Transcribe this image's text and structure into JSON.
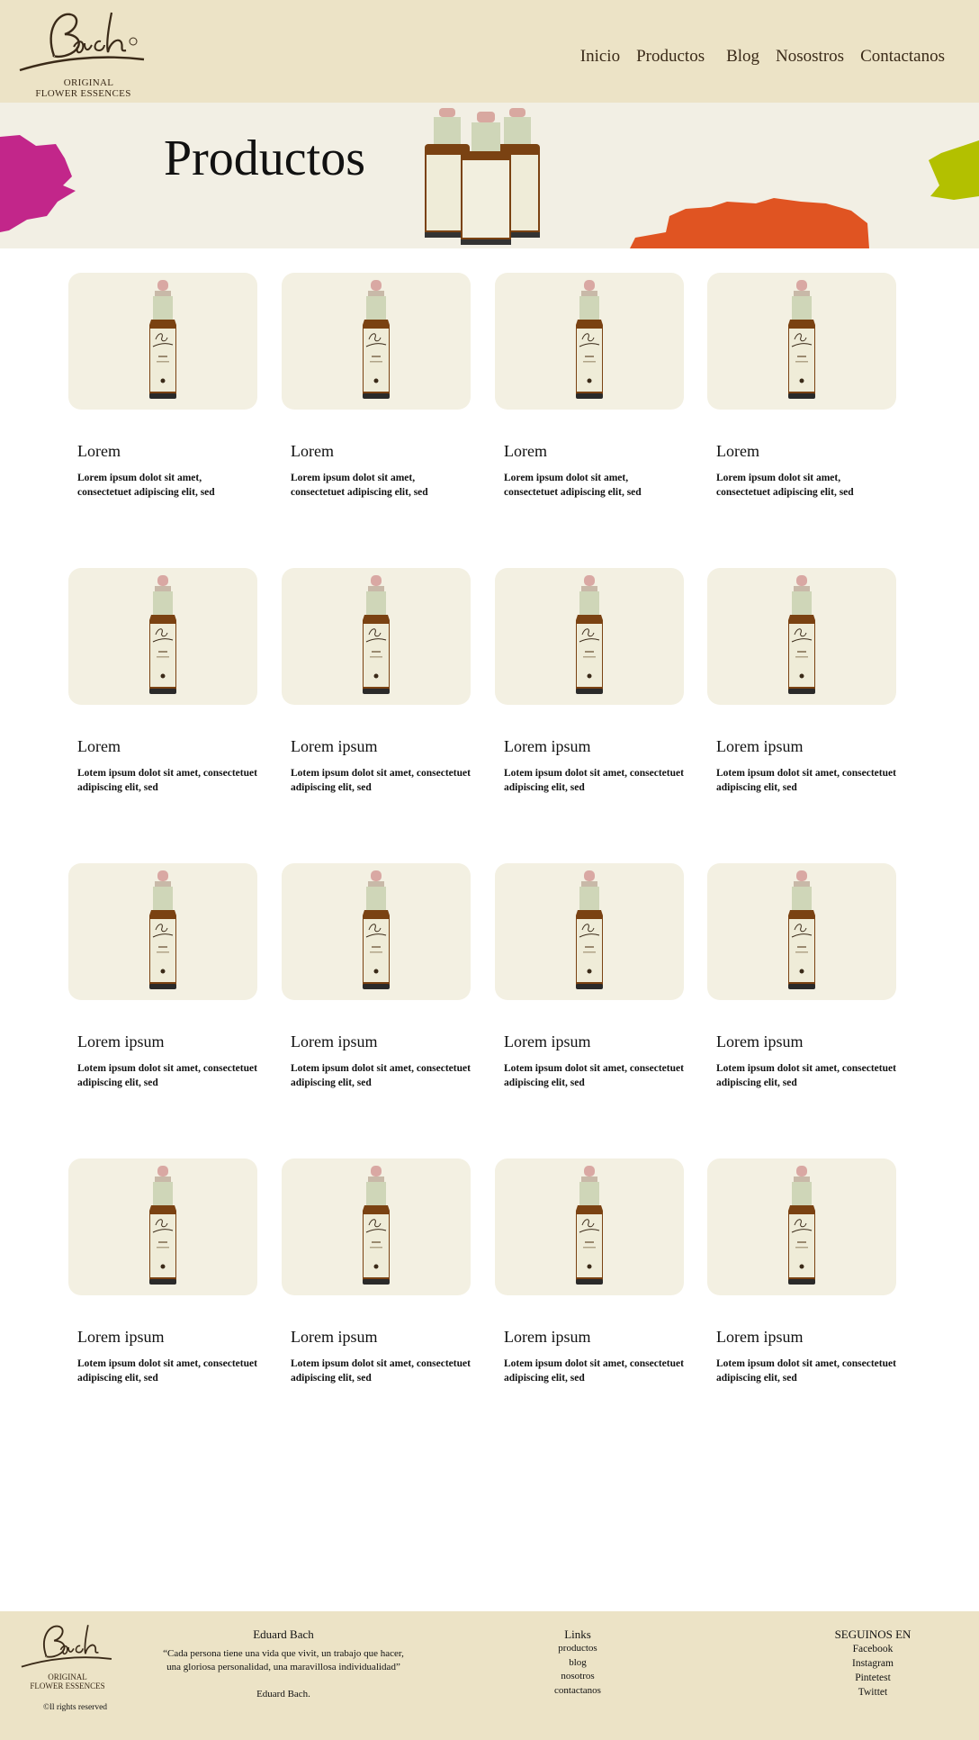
{
  "brand": {
    "logo_script": "Bach",
    "logo_line1": "ORIGINAL",
    "logo_line2": "FLOWER ESSENCES"
  },
  "nav": {
    "items": [
      {
        "label": "Inicio"
      },
      {
        "label": "Productos"
      },
      {
        "label": "Blog"
      },
      {
        "label": "Nosostros"
      },
      {
        "label": "Contactanos"
      }
    ]
  },
  "banner": {
    "title": "Productos"
  },
  "products": [
    {
      "title": "Lorem",
      "desc": "Lorem ipsum dolot sit amet, consectetuet adipiscing elit, sed"
    },
    {
      "title": "Lorem",
      "desc": "Lorem ipsum dolot sit amet, consectetuet adipiscing elit, sed"
    },
    {
      "title": "Lorem",
      "desc": "Lorem ipsum dolot sit amet, consectetuet adipiscing elit, sed"
    },
    {
      "title": "Lorem",
      "desc": "Lorem ipsum dolot sit amet, consectetuet adipiscing elit, sed"
    },
    {
      "title": "Lorem",
      "desc": "Lotem ipsum dolot sit amet, consectetuet adipiscing elit, sed"
    },
    {
      "title": "Lorem ipsum",
      "desc": "Lotem ipsum dolot sit amet, consectetuet adipiscing elit, sed"
    },
    {
      "title": "Lorem ipsum",
      "desc": "Lotem ipsum dolot sit amet, consectetuet adipiscing elit, sed"
    },
    {
      "title": "Lorem ipsum",
      "desc": "Lotem ipsum dolot sit amet, consectetuet adipiscing elit, sed"
    },
    {
      "title": "Lorem ipsum",
      "desc": "Lotem ipsum dolot sit amet, consectetuet adipiscing elit, sed"
    },
    {
      "title": "Lorem ipsum",
      "desc": "Lotem ipsum dolot sit amet, consectetuet adipiscing elit, sed"
    },
    {
      "title": "Lorem ipsum",
      "desc": "Lotem ipsum dolot sit amet, consectetuet adipiscing elit, sed"
    },
    {
      "title": "Lorem ipsum",
      "desc": "Lotem ipsum dolot sit amet, consectetuet adipiscing elit, sed"
    },
    {
      "title": "Lorem ipsum",
      "desc": "Lotem ipsum dolot sit amet, consectetuet adipiscing elit, sed"
    },
    {
      "title": "Lorem ipsum",
      "desc": "Lotem ipsum dolot sit amet, consectetuet adipiscing elit, sed"
    },
    {
      "title": "Lorem ipsum",
      "desc": "Lotem ipsum dolot sit amet, consectetuet adipiscing elit, sed"
    },
    {
      "title": "Lorem ipsum",
      "desc": "Lotem ipsum dolot sit amet, consectetuet adipiscing elit, sed"
    }
  ],
  "footer": {
    "rights": "©ll rights reserved",
    "quote_author": "Eduard Bach",
    "quote_text": "“Cada persona tiene una vida que vivit, un trabajo que hacer, una gloriosa personalidad, una maravillosa individualidad”",
    "quote_sign": "Eduard Bach.",
    "links_title": "Links",
    "links": [
      {
        "label": "productos"
      },
      {
        "label": "blog"
      },
      {
        "label": "nosotros"
      },
      {
        "label": "contactanos"
      }
    ],
    "social_title": "SEGUINOS EN",
    "social": [
      {
        "label": "Facebook"
      },
      {
        "label": "Instagram"
      },
      {
        "label": "Pintetest"
      },
      {
        "label": "Twittet"
      }
    ]
  },
  "colors": {
    "header_bg": "#ece3c6",
    "banner_bg": "#f2efe4",
    "card_bg": "#f3f0e2",
    "brand_brown": "#3a2a18",
    "splash_magenta": "#c2268a",
    "splash_orange": "#e05422",
    "splash_green": "#b3c000"
  }
}
